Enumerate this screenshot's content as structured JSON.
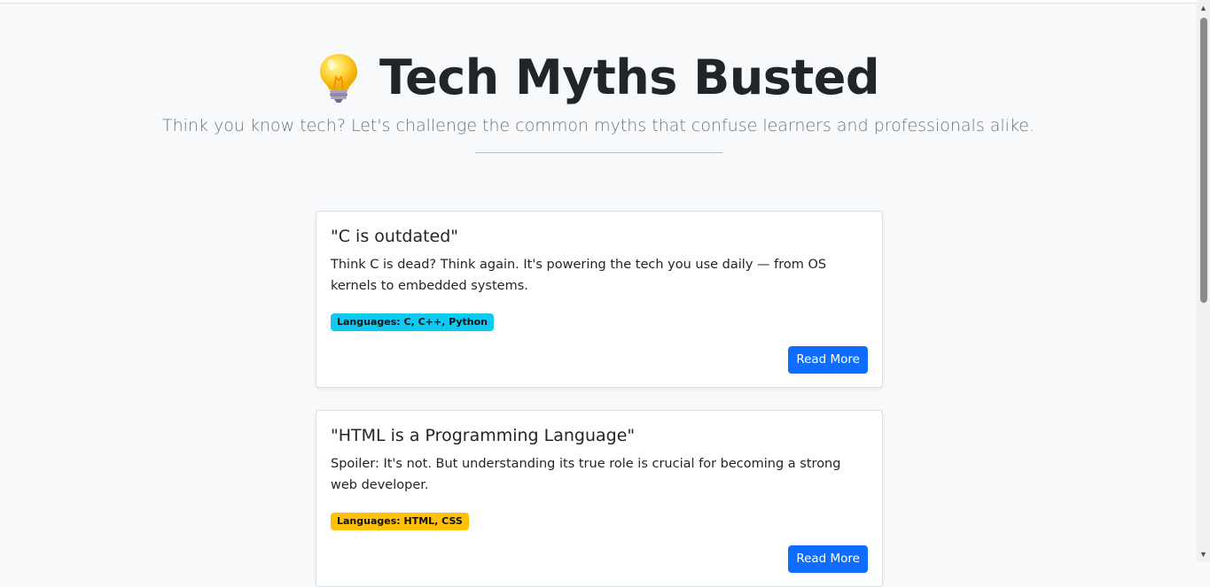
{
  "hero": {
    "icon": "lightbulb-icon",
    "title": "Tech Myths Busted",
    "subtitle": "Think you know tech? Let's challenge the common myths that confuse learners and professionals alike."
  },
  "cards": [
    {
      "title": "\"C is outdated\"",
      "text": "Think C is dead? Think again. It's powering the tech you use daily — from OS kernels to embedded systems.",
      "badge": "Languages: C, C++, Python",
      "badge_color": "#0dcaf0",
      "button": "Read More"
    },
    {
      "title": "\"HTML is a Programming Language\"",
      "text": "Spoiler: It's not. But understanding its true role is crucial for becoming a strong web developer.",
      "badge": "Languages: HTML, CSS",
      "badge_color": "#ffc107",
      "button": "Read More"
    }
  ],
  "colors": {
    "primary": "#0d6efd",
    "background": "#f8f9fa"
  }
}
